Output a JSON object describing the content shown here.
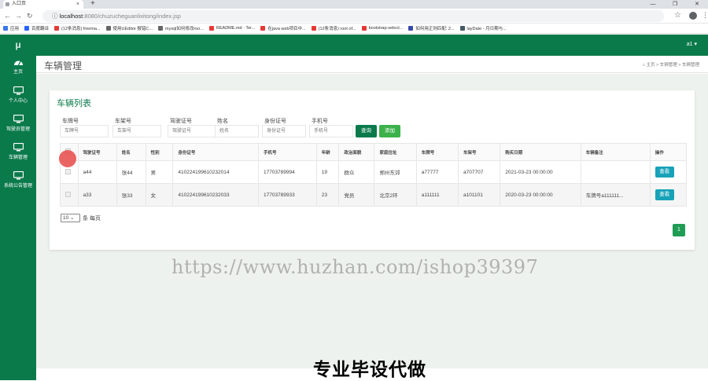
{
  "browser": {
    "tab_title": "入口页",
    "tab_close": "×",
    "new_tab": "+",
    "url_host": "localhost",
    "url_path": ":8080/chuzucheguanlixitong/index.jsp",
    "bookmarks": [
      {
        "label": "应用",
        "color": "#3b78e7"
      },
      {
        "label": "百度翻译",
        "color": "#2962ff"
      },
      {
        "label": "(12条消息) freema...",
        "color": "#e53935"
      },
      {
        "label": "使用UEditor 报错C...",
        "color": "#666666"
      },
      {
        "label": "mysql如何修改roo...",
        "color": "#666666"
      },
      {
        "label": "README.md · Ter...",
        "color": "#e53935"
      },
      {
        "label": "在java web项目中...",
        "color": "#e53935"
      },
      {
        "label": "(12条消息) root of...",
        "color": "#e53935"
      },
      {
        "label": "bootstrap-select...",
        "color": "#e53935"
      },
      {
        "label": "如何用正则匹配: 2...",
        "color": "#3949ab"
      },
      {
        "label": "layDate - 月日期与...",
        "color": "#455a64"
      }
    ]
  },
  "sidebar": {
    "logo": "μ",
    "items": [
      {
        "label": "主页",
        "icon": "dashboard-icon"
      },
      {
        "label": "个人中心",
        "icon": "monitor-icon"
      },
      {
        "label": "驾驶员管理",
        "icon": "monitor-icon"
      },
      {
        "label": "车辆管理",
        "icon": "monitor-icon"
      },
      {
        "label": "系统公告管理",
        "icon": "monitor-icon"
      }
    ]
  },
  "header": {
    "user": "a1 ▾"
  },
  "page": {
    "title": "车辆管理",
    "breadcrumb": "主页 > 车辆管理 > 车辆管理"
  },
  "card": {
    "title": "车辆列表"
  },
  "filters": [
    {
      "label": "车牌号",
      "placeholder": "车牌号"
    },
    {
      "label": "车架号",
      "placeholder": "车架号"
    },
    {
      "label": "驾驶证号",
      "placeholder": "驾驶证号"
    },
    {
      "label": "姓名",
      "placeholder": "姓名"
    },
    {
      "label": "身份证号",
      "placeholder": "身份证号"
    },
    {
      "label": "手机号",
      "placeholder": "手机号"
    }
  ],
  "buttons": {
    "query": "查询",
    "add": "添加"
  },
  "table": {
    "headers": [
      "驾驶证号",
      "姓名",
      "性别",
      "身份证号",
      "手机号",
      "年龄",
      "政治面貌",
      "家庭住址",
      "车牌号",
      "车架号",
      "购买日期",
      "车辆备注",
      "操作"
    ],
    "rows": [
      [
        "a44",
        "张44",
        "男",
        "410224199610232014",
        "17703789994",
        "19",
        "群众",
        "郑州东郊",
        "a77777",
        "a707707",
        "2021-03-23 00:00:00",
        "",
        "查看"
      ],
      [
        "a33",
        "张33",
        "女",
        "410224199610232033",
        "17703789933",
        "23",
        "党员",
        "北京2环",
        "a111111",
        "a101101",
        "2020-03-23 00:00:00",
        "车牌号a111111...",
        "查看"
      ]
    ]
  },
  "pager": {
    "size": "10",
    "size_suffix": "条 每页",
    "page": "1"
  },
  "watermark": "https://www.huzhan.com/ishop39397",
  "overlay": "专业毕设代做"
}
